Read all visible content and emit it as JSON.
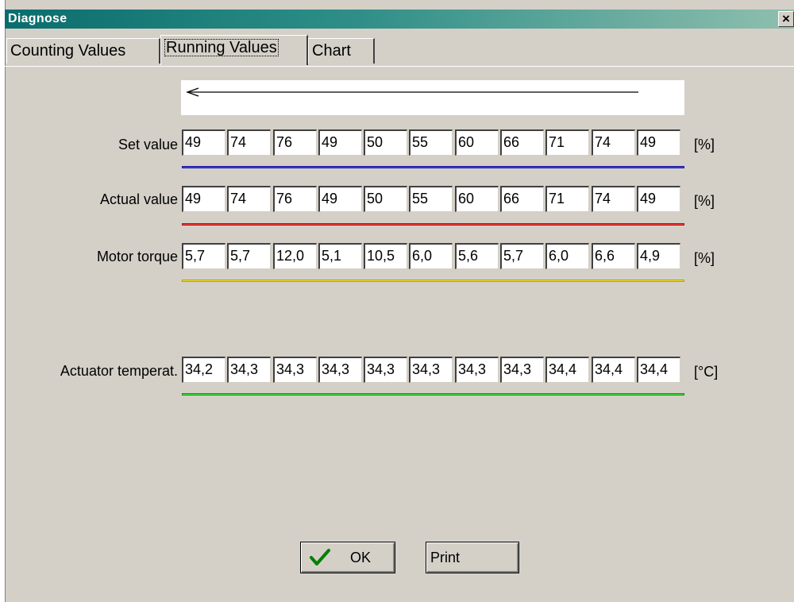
{
  "window": {
    "title": "Diagnose",
    "close_label": "×"
  },
  "tabs": [
    {
      "label": "Counting Values"
    },
    {
      "label": "Running Values"
    },
    {
      "label": "Chart"
    }
  ],
  "arrow_direction": "left",
  "rows": [
    {
      "label": "Set value",
      "unit": "[%]",
      "color": "#2020c0",
      "values": [
        "49",
        "74",
        "76",
        "49",
        "50",
        "55",
        "60",
        "66",
        "71",
        "74",
        "49"
      ]
    },
    {
      "label": "Actual value",
      "unit": "[%]",
      "color": "#e02020",
      "values": [
        "49",
        "74",
        "76",
        "49",
        "50",
        "55",
        "60",
        "66",
        "71",
        "74",
        "49"
      ]
    },
    {
      "label": "Motor torque",
      "unit": "[%]",
      "color": "#e0d020",
      "values": [
        "5,7",
        "5,7",
        "12,0",
        "5,1",
        "10,5",
        "6,0",
        "5,6",
        "5,7",
        "6,0",
        "6,6",
        "4,9"
      ]
    },
    {
      "label": "Actuator temperat.",
      "unit": "[°C]",
      "color": "#20c020",
      "values": [
        "34,2",
        "34,3",
        "34,3",
        "34,3",
        "34,3",
        "34,3",
        "34,3",
        "34,3",
        "34,4",
        "34,4",
        "34,4"
      ]
    }
  ],
  "buttons": {
    "ok_label": "OK",
    "print_label": "Print"
  }
}
